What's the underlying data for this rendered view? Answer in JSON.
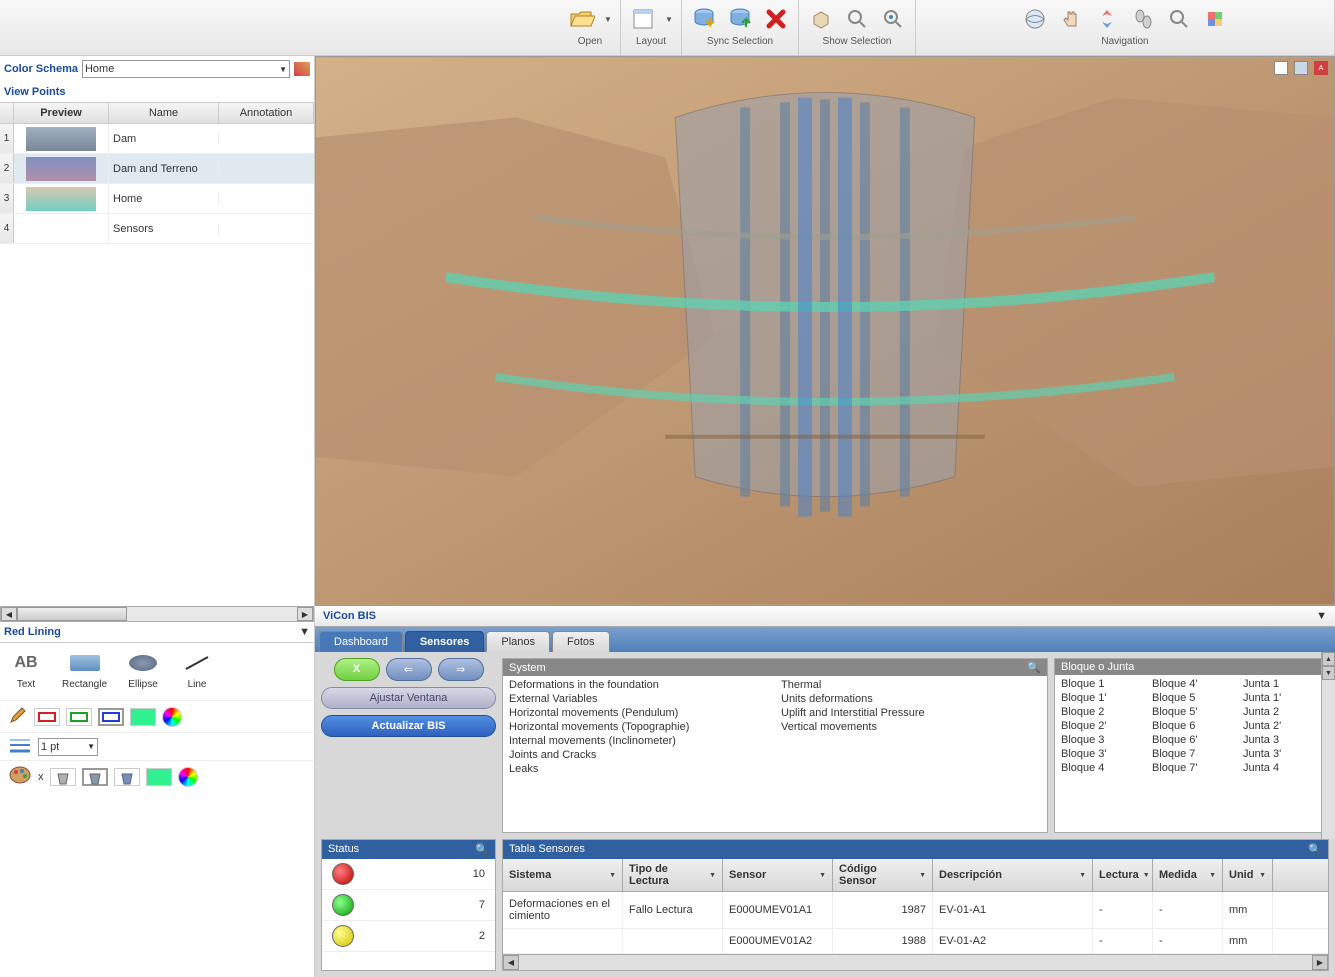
{
  "toolbar": {
    "open": "Open",
    "layout": "Layout",
    "sync": "Sync Selection",
    "show": "Show Selection",
    "nav": "Navigation"
  },
  "color_schema": {
    "label": "Color Schema",
    "value": "Home"
  },
  "viewpoints": {
    "header": "View Points",
    "cols": {
      "preview": "Preview",
      "name": "Name",
      "annotation": "Annotation"
    },
    "rows": [
      {
        "n": "1",
        "name": "Dam"
      },
      {
        "n": "2",
        "name": "Dam and Terreno"
      },
      {
        "n": "3",
        "name": "Home"
      },
      {
        "n": "4",
        "name": "Sensors"
      }
    ]
  },
  "redlining": {
    "header": "Red Lining",
    "tools": {
      "text": "Text",
      "rectangle": "Rectangle",
      "ellipse": "Ellipse",
      "line": "Line"
    },
    "lineweight": "1 pt",
    "x": "x"
  },
  "vicon": {
    "title": "ViCon BIS",
    "tabs": {
      "dashboard": "Dashboard",
      "sensores": "Sensores",
      "planos": "Planos",
      "fotos": "Fotos"
    },
    "buttons": {
      "x": "X",
      "ajustar": "Ajustar Ventana",
      "actualizar": "Actualizar BIS"
    },
    "system": {
      "header": "System",
      "col1": [
        "Deformations in the foundation",
        "External Variables",
        "Horizontal movements (Pendulum)",
        "Horizontal movements (Topographie)",
        "Internal movements (Inclinometer)",
        "Joints and Cracks",
        "Leaks"
      ],
      "col2": [
        "Thermal",
        "Units deformations",
        "Uplift and Interstitial Pressure",
        "Vertical movements"
      ]
    },
    "bloque": {
      "header": "Bloque o Junta",
      "col1": [
        "Bloque 1",
        "Bloque 1'",
        "Bloque 2",
        "Bloque 2'",
        "Bloque 3",
        "Bloque 3'",
        "Bloque 4"
      ],
      "col2": [
        "Bloque 4'",
        "Bloque 5",
        "Bloque 5'",
        "Bloque 6",
        "Bloque 6'",
        "Bloque 7",
        "Bloque 7'"
      ],
      "col3": [
        "Junta 1",
        "Junta 1'",
        "Junta 2",
        "Junta 2'",
        "Junta 3",
        "Junta 3'",
        "Junta 4"
      ]
    },
    "status": {
      "header": "Status",
      "red": "10",
      "green": "7",
      "yellow": "2"
    },
    "tabla": {
      "header": "Tabla Sensores",
      "cols": {
        "sistema": "Sistema",
        "tipo": "Tipo de Lectura",
        "sensor": "Sensor",
        "codigo": "Código Sensor",
        "desc": "Descripción",
        "lectura": "Lectura",
        "medida": "Medida",
        "unidad": "Unid"
      },
      "rows": [
        {
          "sistema": "Deformaciones en el cimiento",
          "tipo": "Fallo Lectura",
          "sensor": "E000UMEV01A1",
          "codigo": "1987",
          "desc": "EV-01-A1",
          "lectura": "-",
          "medida": "-",
          "unidad": "mm"
        },
        {
          "sistema": "",
          "tipo": "",
          "sensor": "E000UMEV01A2",
          "codigo": "1988",
          "desc": "EV-01-A2",
          "lectura": "-",
          "medida": "-",
          "unidad": "mm"
        }
      ]
    }
  }
}
